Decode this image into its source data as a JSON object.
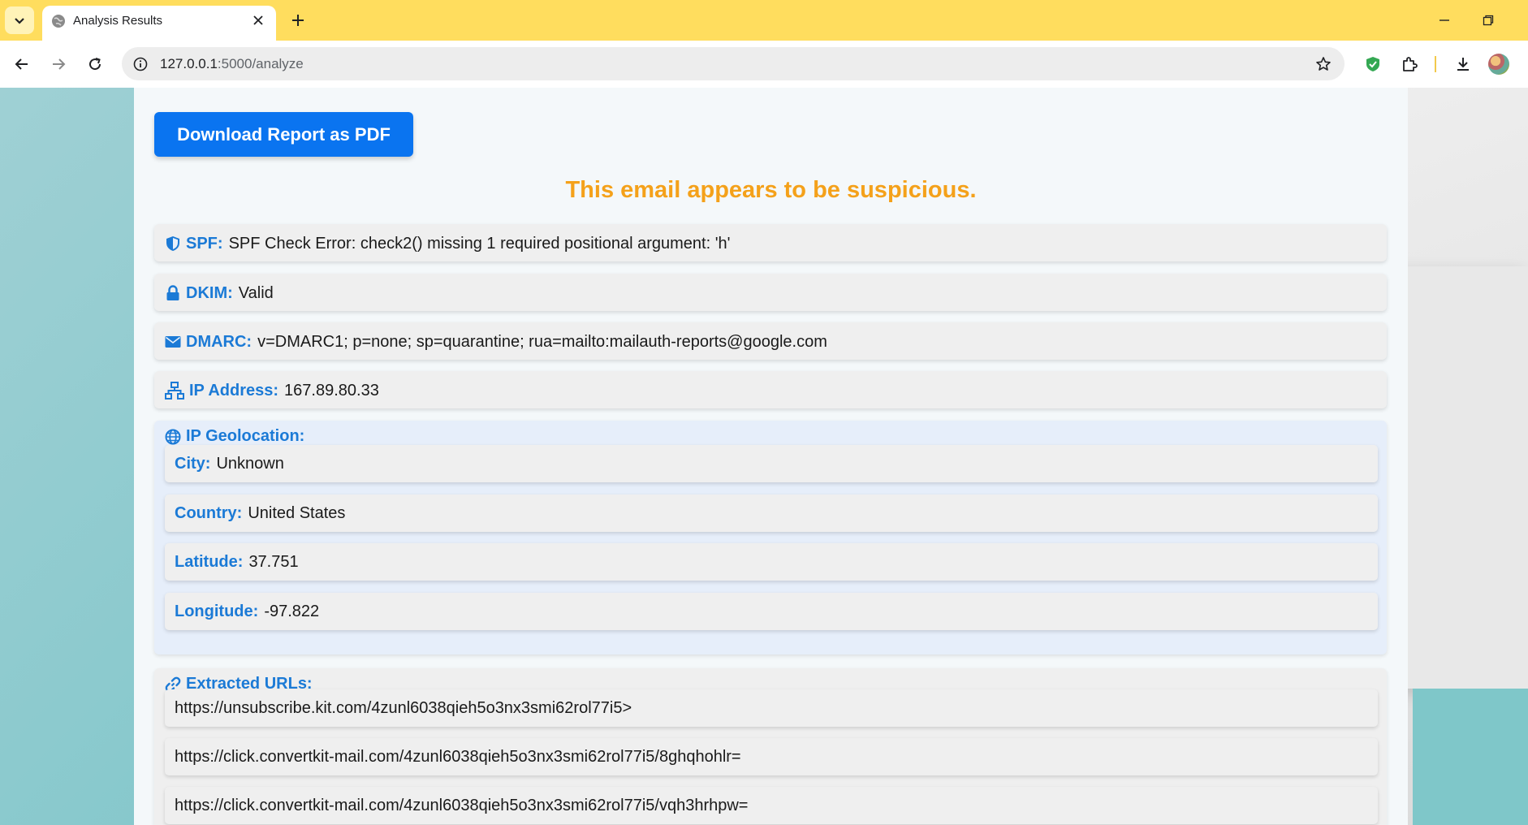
{
  "browser": {
    "tab_title": "Analysis Results",
    "url_host": "127.0.0.1",
    "url_path": ":5000/analyze"
  },
  "page": {
    "download_button": "Download Report as PDF",
    "verdict": "This email appears to be suspicious.",
    "verdict_color": "#f4a11a",
    "accent_color": "#1b7ad6",
    "checks": [
      {
        "icon": "shield-icon",
        "label": "SPF:",
        "value": "SPF Check Error: check2() missing 1 required positional argument: 'h'"
      },
      {
        "icon": "lock-icon",
        "label": "DKIM:",
        "value": "Valid"
      },
      {
        "icon": "envelope-icon",
        "label": "DMARC:",
        "value": "v=DMARC1; p=none; sp=quarantine; rua=mailto:mailauth-reports@google.com"
      },
      {
        "icon": "network-icon",
        "label": "IP Address:",
        "value": "167.89.80.33"
      }
    ],
    "geolocation": {
      "heading": "IP Geolocation:",
      "items": [
        {
          "label": "City:",
          "value": "Unknown"
        },
        {
          "label": "Country:",
          "value": "United States"
        },
        {
          "label": "Latitude:",
          "value": "37.751"
        },
        {
          "label": "Longitude:",
          "value": "-97.822"
        }
      ]
    },
    "urls": {
      "heading": "Extracted URLs:",
      "items": [
        "https://unsubscribe.kit.com/4zunl6038qieh5o3nx3smi62rol77i5>",
        "https://click.convertkit-mail.com/4zunl6038qieh5o3nx3smi62rol77i5/8ghqhohlr=",
        "https://click.convertkit-mail.com/4zunl6038qieh5o3nx3smi62rol77i5/vqh3hrhpw="
      ]
    }
  }
}
